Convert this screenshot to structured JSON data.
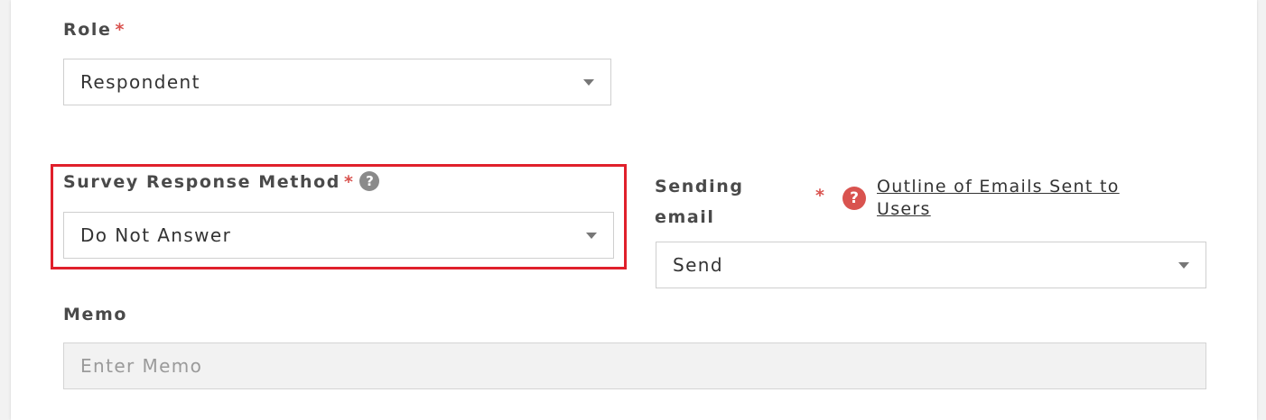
{
  "colors": {
    "required": "#d9534f",
    "highlight": "#e0202b",
    "help_icon": "#8a8a8a",
    "input_disabled_bg": "#f2f2f2"
  },
  "role": {
    "label": "Role",
    "required_mark": "*",
    "value": "Respondent"
  },
  "survey_response_method": {
    "label": "Survey Response Method",
    "required_mark": "*",
    "help_icon": "question-circle-icon",
    "value": "Do Not Answer"
  },
  "sending_email": {
    "label_line1": "Sending",
    "label_line2": "email",
    "required_mark": "*",
    "help_icon": "question-circle-icon",
    "link_line1": "Outline of Emails Sent to",
    "link_line2": "Users",
    "value": "Send"
  },
  "memo": {
    "label": "Memo",
    "placeholder": "Enter Memo",
    "value": ""
  }
}
